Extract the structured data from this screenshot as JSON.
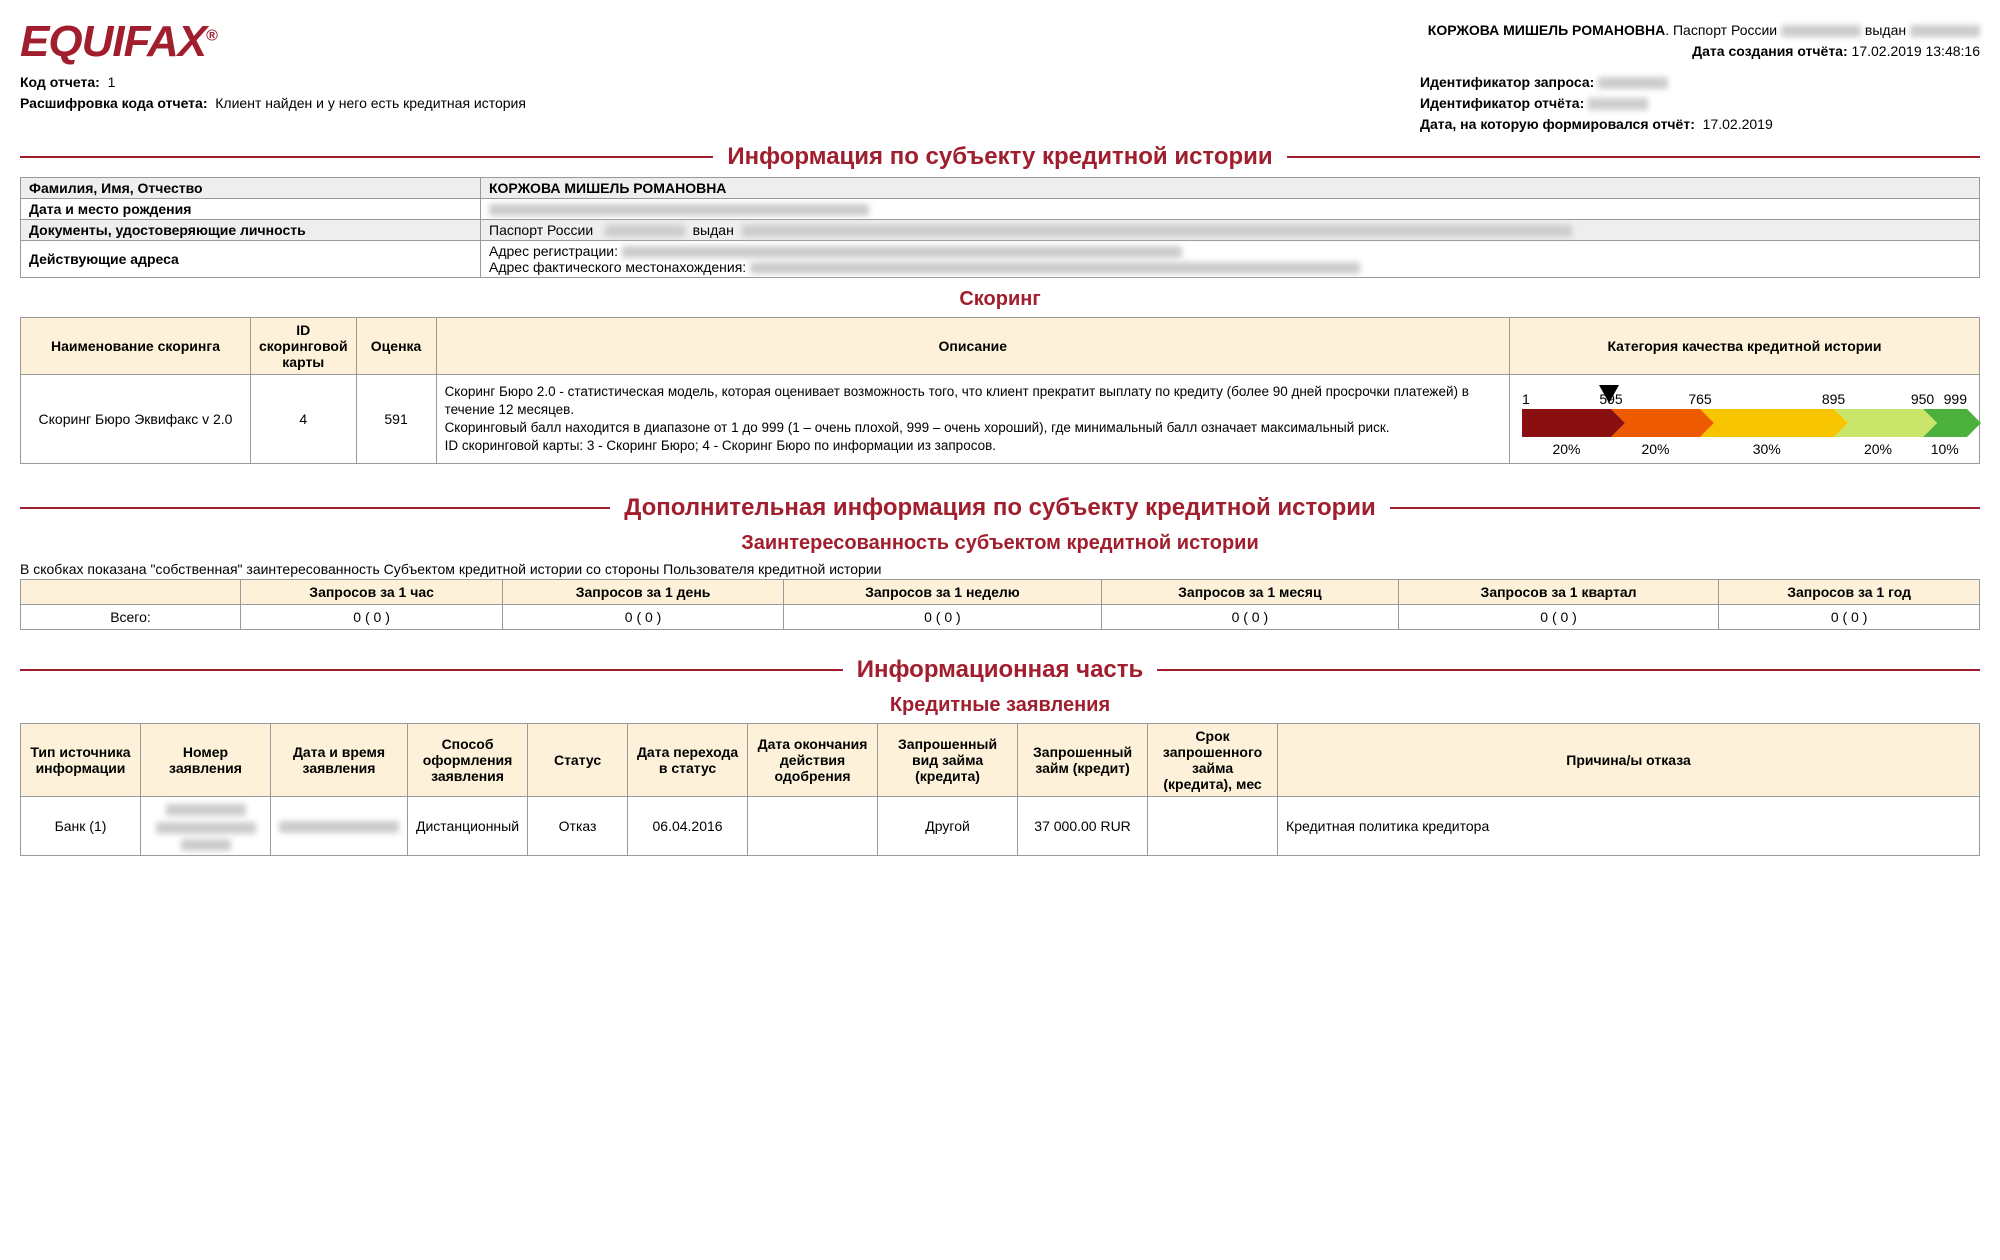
{
  "brand": "EQUIFAX",
  "header": {
    "name": "КОРЖОВА МИШЕЛЬ РОМАНОВНА",
    "passport_label": "Паспорт России",
    "issued_word": "выдан",
    "report_date_label": "Дата создания отчёта:",
    "report_date_value": "17.02.2019 13:48:16"
  },
  "meta": {
    "report_code_label": "Код отчета:",
    "report_code_value": "1",
    "decode_label": "Расшифровка кода отчета:",
    "decode_value": "Клиент найден и у него есть кредитная история",
    "request_id_label": "Идентификатор запроса:",
    "report_id_label": "Идентификатор отчёта:",
    "asof_label": "Дата, на которую формировался отчёт:",
    "asof_value": "17.02.2019"
  },
  "section_subject": "Информация по субъекту кредитной истории",
  "subject_rows": {
    "fio_label": "Фамилия, Имя, Отчество",
    "fio_value": "КОРЖОВА МИШЕЛЬ РОМАНОВНА",
    "dob_label": "Дата и место рождения",
    "docs_label": "Документы, удостоверяющие личность",
    "docs_prefix": "Паспорт России",
    "docs_issued": "выдан",
    "addr_label": "Действующие адреса",
    "addr_reg": "Адрес регистрации:",
    "addr_fact": "Адрес фактического местонахождения:"
  },
  "scoring_title": "Скоринг",
  "scoring": {
    "headers": {
      "name": "Наименование скоринга",
      "card_id": "ID скоринговой карты",
      "score": "Оценка",
      "desc": "Описание",
      "cat": "Категория качества кредитной истории"
    },
    "row": {
      "name": "Скоринг Бюро Эквифакс v 2.0",
      "card_id": "4",
      "score": "591",
      "desc1": "Скоринг Бюро 2.0 - статистическая модель, которая оценивает возможность того, что клиент прекратит выплату по кредиту (более 90 дней просрочки платежей) в течение 12 месяцев.",
      "desc2": "Скоринговый балл находится в диапазоне от 1 до 999 (1 – очень плохой, 999 – очень хороший), где минимальный балл означает максимальный риск.",
      "desc3": "ID скоринговой карты: 3 - Скоринг Бюро; 4 - Скоринг Бюро по информации из запросов."
    }
  },
  "chart_data": {
    "type": "bar",
    "value": 591,
    "ticks": [
      1,
      595,
      765,
      895,
      950,
      999
    ],
    "segments": [
      {
        "color": "#8a0f11",
        "pct": 20,
        "range": [
          1,
          595
        ]
      },
      {
        "color": "#ee5a00",
        "pct": 20,
        "range": [
          595,
          765
        ]
      },
      {
        "color": "#f7c500",
        "pct": 30,
        "range": [
          765,
          895
        ]
      },
      {
        "color": "#c9e66a",
        "pct": 20,
        "range": [
          895,
          950
        ]
      },
      {
        "color": "#4bb13c",
        "pct": 10,
        "range": [
          950,
          999
        ]
      }
    ],
    "arrow_position_pct": 19.5,
    "title": "Категория качества кредитной истории",
    "xlabel": "",
    "ylabel": "",
    "ylim": [
      1,
      999
    ]
  },
  "section_additional": "Дополнительная информация по субъекту кредитной истории",
  "interest_title": "Заинтересованность субъектом кредитной истории",
  "interest_note": "В скобках показана \"собственная\" заинтересованность Субъектом кредитной истории со стороны Пользователя кредитной истории",
  "interest": {
    "headers": [
      "",
      "Запросов за 1 час",
      "Запросов за 1 день",
      "Запросов за 1 неделю",
      "Запросов за 1 месяц",
      "Запросов за 1 квартал",
      "Запросов за 1 год"
    ],
    "row_label": "Всего:",
    "values": [
      "0 ( 0 )",
      "0 ( 0 )",
      "0 ( 0 )",
      "0 ( 0 )",
      "0 ( 0 )",
      "0 ( 0 )"
    ]
  },
  "section_info": "Информационная часть",
  "apps_title": "Кредитные заявления",
  "apps": {
    "headers": [
      "Тип источника информации",
      "Номер заявления",
      "Дата и время заявления",
      "Способ оформления заявления",
      "Статус",
      "Дата перехода в статус",
      "Дата окончания действия одобрения",
      "Запрошенный вид займа (кредита)",
      "Запрошенный займ (кредит)",
      "Срок запрошенного займа (кредита), мес",
      "Причина/ы отказа"
    ],
    "row": {
      "source": "Банк  (1)",
      "method": "Дистанционный",
      "status": "Отказ",
      "status_date": "06.04.2016",
      "end_date": "",
      "loan_type": "Другой",
      "amount": "37 000.00  RUR",
      "term": "",
      "reason": "Кредитная политика кредитора"
    }
  }
}
